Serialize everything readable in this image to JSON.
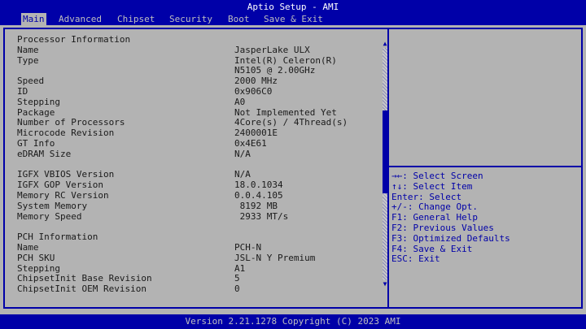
{
  "title": "Aptio Setup - AMI",
  "menu": [
    "Main",
    "Advanced",
    "Chipset",
    "Security",
    "Boot",
    "Save & Exit"
  ],
  "info_rows": [
    {
      "label": "Processor Information",
      "value": ""
    },
    {
      "label": "Name",
      "value": "JasperLake ULX"
    },
    {
      "label": "Type",
      "value": "Intel(R) Celeron(R)"
    },
    {
      "label": "",
      "value": "N5105 @ 2.00GHz"
    },
    {
      "label": "Speed",
      "value": "2000 MHz"
    },
    {
      "label": "ID",
      "value": "0x906C0"
    },
    {
      "label": "Stepping",
      "value": "A0"
    },
    {
      "label": "Package",
      "value": "Not Implemented Yet"
    },
    {
      "label": "Number of Processors",
      "value": "4Core(s) / 4Thread(s)"
    },
    {
      "label": "Microcode Revision",
      "value": "2400001E"
    },
    {
      "label": "GT Info",
      "value": "0x4E61"
    },
    {
      "label": "eDRAM Size",
      "value": "N/A"
    },
    {
      "label": "",
      "value": ""
    },
    {
      "label": "IGFX VBIOS Version",
      "value": "N/A"
    },
    {
      "label": "IGFX GOP Version",
      "value": "18.0.1034"
    },
    {
      "label": "Memory RC Version",
      "value": "0.0.4.105"
    },
    {
      "label": "System Memory",
      "value": " 8192 MB"
    },
    {
      "label": "Memory Speed",
      "value": " 2933 MT/s"
    },
    {
      "label": "",
      "value": ""
    },
    {
      "label": "PCH Information",
      "value": ""
    },
    {
      "label": "Name",
      "value": "PCH-N"
    },
    {
      "label": "PCH SKU",
      "value": "JSL-N Y Premium"
    },
    {
      "label": "Stepping",
      "value": "A1"
    },
    {
      "label": "ChipsetInit Base Revision",
      "value": "5"
    },
    {
      "label": "ChipsetInit OEM Revision",
      "value": "0"
    }
  ],
  "scroll_position": 0.42,
  "help": [
    "→←: Select Screen",
    "↑↓: Select Item",
    "Enter: Select",
    "+/-: Change Opt.",
    "F1: General Help",
    "F2: Previous Values",
    "F3: Optimized Defaults",
    "F4: Save & Exit",
    "ESC: Exit"
  ],
  "footer": "Version 2.21.1278 Copyright (C) 2023 AMI"
}
